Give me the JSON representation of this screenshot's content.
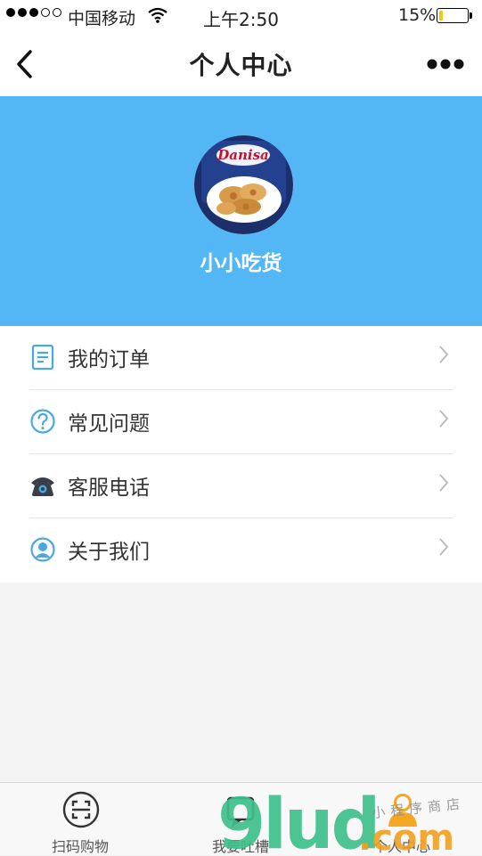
{
  "status_bar": {
    "carrier": "中国移动",
    "time": "上午2:50",
    "battery": "15%",
    "battery_level": 0.15,
    "signal_bars_filled": 3,
    "signal_bars_total": 5
  },
  "nav": {
    "title": "个人中心",
    "back_icon": "chevron-left-icon",
    "more_icon": "more-dots-icon"
  },
  "profile": {
    "username": "小小吃货",
    "avatar_brand": "Danisa",
    "header_color": "#53b7f5"
  },
  "menu": {
    "items": [
      {
        "label": "我的订单",
        "icon": "order-document-icon"
      },
      {
        "label": "常见问题",
        "icon": "question-icon"
      },
      {
        "label": "客服电话",
        "icon": "telephone-icon"
      },
      {
        "label": "关于我们",
        "icon": "user-circle-icon"
      }
    ]
  },
  "tab_bar": {
    "tabs": [
      {
        "label": "扫码购物",
        "icon": "scan-icon"
      },
      {
        "label": "我要吐槽",
        "icon": "feedback-icon"
      },
      {
        "label": "个人中心",
        "icon": "profile-icon"
      }
    ]
  },
  "watermark": {
    "logo_text": "9lud",
    "domain_text": ".com",
    "tag_text": "小程序商店"
  },
  "colors": {
    "accent": "#53b7f5",
    "icon_blue": "#4aa8e0",
    "active_tab": "#f5a623",
    "watermark_green": "#3dbf8a",
    "watermark_orange": "#f0a020"
  }
}
